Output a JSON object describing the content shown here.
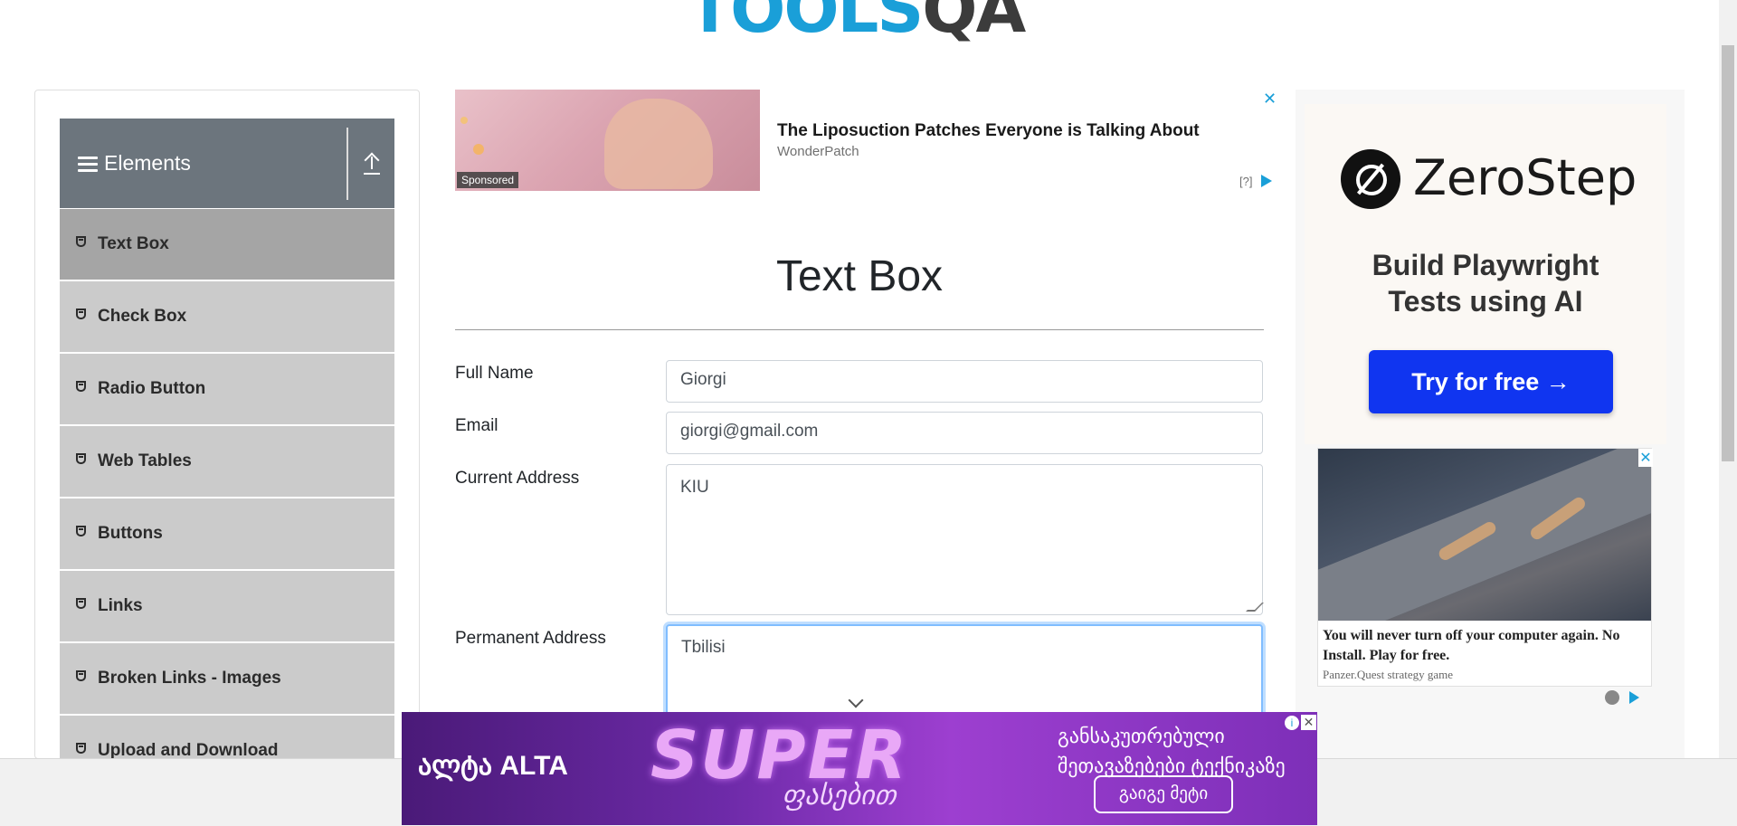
{
  "logo": {
    "part1": "TOOLS",
    "part2": "QA"
  },
  "sidebar": {
    "group_title": "Elements",
    "items": [
      {
        "label": "Text Box",
        "active": true
      },
      {
        "label": "Check Box"
      },
      {
        "label": "Radio Button"
      },
      {
        "label": "Web Tables"
      },
      {
        "label": "Buttons"
      },
      {
        "label": "Links"
      },
      {
        "label": "Broken Links - Images"
      },
      {
        "label": "Upload and Download"
      }
    ]
  },
  "top_ad": {
    "headline": "The Liposuction Patches Everyone is Talking About",
    "brand": "WonderPatch",
    "sponsored": "Sponsored",
    "info": "[?]",
    "close": "✕"
  },
  "main": {
    "title": "Text Box",
    "fields": {
      "full_name": {
        "label": "Full Name",
        "value": "Giorgi"
      },
      "email": {
        "label": "Email",
        "value": "giorgi@gmail.com"
      },
      "current_address": {
        "label": "Current Address",
        "value": "KIU"
      },
      "permanent_address": {
        "label": "Permanent Address",
        "value": "Tbilisi"
      }
    }
  },
  "right_ad": {
    "brand": "ZeroStep",
    "tagline": "Build Playwright Tests using AI",
    "cta": "Try for free →",
    "game_text": "You will never turn off your computer again. No Install. Play for free.",
    "game_brand": "Panzer.Quest strategy game",
    "close": "✕"
  },
  "bottom_banner": {
    "brand": "ალტა ALTA",
    "super": "SUPER",
    "subtitle": "ფასებით",
    "geo_line1": "განსაკუთრებული",
    "geo_line2": "შეთავაზებები ტექნიკაზე",
    "cta": "გაიგე მეტი",
    "info": "i",
    "close": "✕"
  },
  "colors": {
    "brand_blue": "#1a9fd8",
    "sidebar_header": "#6c757d",
    "menu_item": "#cbcbcb",
    "menu_item_active": "#a5a5a5",
    "cta_blue": "#1035f0",
    "focus_border": "#80bdff"
  },
  "icons": {
    "menu": "hamburger-icon",
    "collapse": "upload-arrow-icon",
    "menu_item": "html5-shield-icon",
    "scroll": "chevron-down-icon"
  }
}
